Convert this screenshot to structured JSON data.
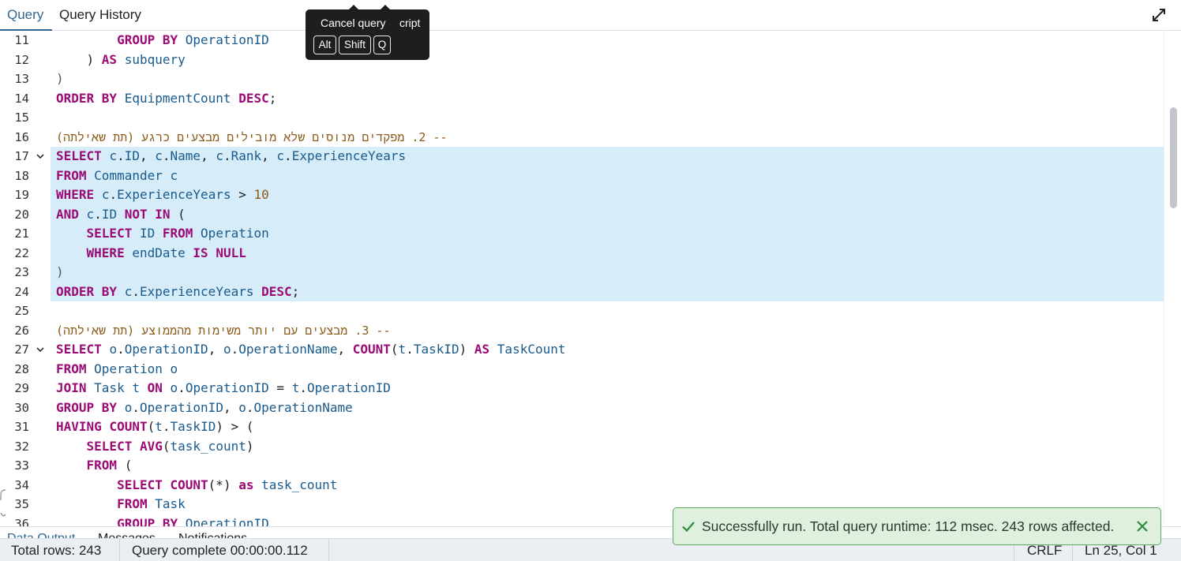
{
  "tabs": [
    {
      "label": "Query",
      "active": true
    },
    {
      "label": "Query History",
      "active": false
    }
  ],
  "tooltip": {
    "title": "Cancel query",
    "tail": "cript",
    "keys": [
      "Alt",
      "Shift",
      "Q"
    ]
  },
  "editor": {
    "lines": [
      {
        "n": "11",
        "fold": false,
        "hl": false,
        "tokens": [
          [
            "",
            "        "
          ],
          [
            "kw",
            "GROUP BY"
          ],
          [
            "",
            " "
          ],
          [
            "id",
            "OperationID"
          ]
        ]
      },
      {
        "n": "12",
        "fold": false,
        "hl": false,
        "tokens": [
          [
            "",
            "    ) "
          ],
          [
            "kw",
            "AS"
          ],
          [
            "",
            " "
          ],
          [
            "id",
            "subquery"
          ]
        ]
      },
      {
        "n": "13",
        "fold": false,
        "hl": false,
        "tokens": [
          [
            "op",
            ")"
          ]
        ]
      },
      {
        "n": "14",
        "fold": false,
        "hl": false,
        "tokens": [
          [
            "kw",
            "ORDER BY"
          ],
          [
            "",
            " "
          ],
          [
            "id",
            "EquipmentCount"
          ],
          [
            "",
            " "
          ],
          [
            "kw",
            "DESC"
          ],
          [
            "",
            ";"
          ]
        ]
      },
      {
        "n": "15",
        "fold": false,
        "hl": false,
        "tokens": []
      },
      {
        "n": "16",
        "fold": false,
        "hl": false,
        "tokens": [
          [
            "cm",
            "-- 2. מפקדים מנוסים שלא מובילים מבצעים כרגע (תת שאילתה)"
          ]
        ]
      },
      {
        "n": "17",
        "fold": true,
        "hl": true,
        "tokens": [
          [
            "kw",
            "SELECT"
          ],
          [
            "",
            " "
          ],
          [
            "id",
            "c"
          ],
          [
            "",
            "."
          ],
          [
            "id",
            "ID"
          ],
          [
            "",
            ", "
          ],
          [
            "id",
            "c"
          ],
          [
            "",
            "."
          ],
          [
            "id",
            "Name"
          ],
          [
            "",
            ", "
          ],
          [
            "id",
            "c"
          ],
          [
            "",
            "."
          ],
          [
            "id",
            "Rank"
          ],
          [
            "",
            ", "
          ],
          [
            "id",
            "c"
          ],
          [
            "",
            "."
          ],
          [
            "id",
            "ExperienceYears"
          ]
        ]
      },
      {
        "n": "18",
        "fold": false,
        "hl": true,
        "tokens": [
          [
            "kw",
            "FROM"
          ],
          [
            "",
            " "
          ],
          [
            "id",
            "Commander"
          ],
          [
            "",
            " "
          ],
          [
            "id",
            "c"
          ]
        ]
      },
      {
        "n": "19",
        "fold": false,
        "hl": true,
        "tokens": [
          [
            "kw",
            "WHERE"
          ],
          [
            "",
            " "
          ],
          [
            "id",
            "c"
          ],
          [
            "",
            "."
          ],
          [
            "id",
            "ExperienceYears"
          ],
          [
            "",
            " > "
          ],
          [
            "num",
            "10"
          ]
        ]
      },
      {
        "n": "20",
        "fold": false,
        "hl": true,
        "tokens": [
          [
            "kw",
            "AND"
          ],
          [
            "",
            " "
          ],
          [
            "id",
            "c"
          ],
          [
            "",
            "."
          ],
          [
            "id",
            "ID"
          ],
          [
            "",
            " "
          ],
          [
            "kw",
            "NOT IN"
          ],
          [
            "",
            " ("
          ]
        ]
      },
      {
        "n": "21",
        "fold": false,
        "hl": true,
        "tokens": [
          [
            "",
            "    "
          ],
          [
            "kw",
            "SELECT"
          ],
          [
            "",
            " "
          ],
          [
            "id",
            "ID"
          ],
          [
            "",
            " "
          ],
          [
            "kw",
            "FROM"
          ],
          [
            "",
            " "
          ],
          [
            "id",
            "Operation"
          ]
        ]
      },
      {
        "n": "22",
        "fold": false,
        "hl": true,
        "tokens": [
          [
            "",
            "    "
          ],
          [
            "kw",
            "WHERE"
          ],
          [
            "",
            " "
          ],
          [
            "id",
            "endDate"
          ],
          [
            "",
            " "
          ],
          [
            "kw",
            "IS NULL"
          ]
        ]
      },
      {
        "n": "23",
        "fold": false,
        "hl": true,
        "tokens": [
          [
            "op",
            ")"
          ]
        ]
      },
      {
        "n": "24",
        "fold": false,
        "hl": true,
        "tokens": [
          [
            "kw",
            "ORDER BY"
          ],
          [
            "",
            " "
          ],
          [
            "id",
            "c"
          ],
          [
            "",
            "."
          ],
          [
            "id",
            "ExperienceYears"
          ],
          [
            "",
            " "
          ],
          [
            "kw",
            "DESC"
          ],
          [
            "",
            ";"
          ]
        ]
      },
      {
        "n": "25",
        "fold": false,
        "hl": false,
        "tokens": []
      },
      {
        "n": "26",
        "fold": false,
        "hl": false,
        "tokens": [
          [
            "cm",
            "-- 3. מבצעים עם יותר משימות מהממוצע (תת שאילתה)"
          ]
        ]
      },
      {
        "n": "27",
        "fold": true,
        "hl": false,
        "tokens": [
          [
            "kw",
            "SELECT"
          ],
          [
            "",
            " "
          ],
          [
            "id",
            "o"
          ],
          [
            "",
            "."
          ],
          [
            "id",
            "OperationID"
          ],
          [
            "",
            ", "
          ],
          [
            "id",
            "o"
          ],
          [
            "",
            "."
          ],
          [
            "id",
            "OperationName"
          ],
          [
            "",
            ", "
          ],
          [
            "kw",
            "COUNT"
          ],
          [
            "",
            "("
          ],
          [
            "id",
            "t"
          ],
          [
            "",
            "."
          ],
          [
            "id",
            "TaskID"
          ],
          [
            "",
            ") "
          ],
          [
            "kw",
            "AS"
          ],
          [
            "",
            " "
          ],
          [
            "id",
            "TaskCount"
          ]
        ]
      },
      {
        "n": "28",
        "fold": false,
        "hl": false,
        "tokens": [
          [
            "kw",
            "FROM"
          ],
          [
            "",
            " "
          ],
          [
            "id",
            "Operation"
          ],
          [
            "",
            " "
          ],
          [
            "id",
            "o"
          ]
        ]
      },
      {
        "n": "29",
        "fold": false,
        "hl": false,
        "tokens": [
          [
            "kw",
            "JOIN"
          ],
          [
            "",
            " "
          ],
          [
            "id",
            "Task"
          ],
          [
            "",
            " "
          ],
          [
            "id",
            "t"
          ],
          [
            "",
            " "
          ],
          [
            "kw",
            "ON"
          ],
          [
            "",
            " "
          ],
          [
            "id",
            "o"
          ],
          [
            "",
            "."
          ],
          [
            "id",
            "OperationID"
          ],
          [
            "",
            " = "
          ],
          [
            "id",
            "t"
          ],
          [
            "",
            "."
          ],
          [
            "id",
            "OperationID"
          ]
        ]
      },
      {
        "n": "30",
        "fold": false,
        "hl": false,
        "tokens": [
          [
            "kw",
            "GROUP BY"
          ],
          [
            "",
            " "
          ],
          [
            "id",
            "o"
          ],
          [
            "",
            "."
          ],
          [
            "id",
            "OperationID"
          ],
          [
            "",
            ", "
          ],
          [
            "id",
            "o"
          ],
          [
            "",
            "."
          ],
          [
            "id",
            "OperationName"
          ]
        ]
      },
      {
        "n": "31",
        "fold": false,
        "hl": false,
        "tokens": [
          [
            "kw",
            "HAVING"
          ],
          [
            "",
            " "
          ],
          [
            "kw",
            "COUNT"
          ],
          [
            "",
            "("
          ],
          [
            "id",
            "t"
          ],
          [
            "",
            "."
          ],
          [
            "id",
            "TaskID"
          ],
          [
            "",
            ") > ("
          ]
        ]
      },
      {
        "n": "32",
        "fold": false,
        "hl": false,
        "tokens": [
          [
            "",
            "    "
          ],
          [
            "kw",
            "SELECT"
          ],
          [
            "",
            " "
          ],
          [
            "kw",
            "AVG"
          ],
          [
            "",
            "("
          ],
          [
            "id",
            "task_count"
          ],
          [
            "",
            ")"
          ]
        ]
      },
      {
        "n": "33",
        "fold": false,
        "hl": false,
        "tokens": [
          [
            "",
            "    "
          ],
          [
            "kw",
            "FROM"
          ],
          [
            "",
            " ("
          ]
        ]
      },
      {
        "n": "34",
        "fold": false,
        "hl": false,
        "tokens": [
          [
            "",
            "        "
          ],
          [
            "kw",
            "SELECT"
          ],
          [
            "",
            " "
          ],
          [
            "kw",
            "COUNT"
          ],
          [
            "",
            "(*) "
          ],
          [
            "kw",
            "as"
          ],
          [
            "",
            " "
          ],
          [
            "id",
            "task_count"
          ]
        ]
      },
      {
        "n": "35",
        "fold": false,
        "hl": false,
        "tokens": [
          [
            "",
            "        "
          ],
          [
            "kw",
            "FROM"
          ],
          [
            "",
            " "
          ],
          [
            "id",
            "Task"
          ]
        ]
      },
      {
        "n": "36",
        "fold": false,
        "hl": false,
        "tokens": [
          [
            "",
            "        "
          ],
          [
            "kw",
            "GROUP BY"
          ],
          [
            "",
            " "
          ],
          [
            "id",
            "OperationID"
          ]
        ]
      }
    ]
  },
  "bottom_tabs": [
    {
      "label": "Data Output"
    },
    {
      "label": "Messages"
    },
    {
      "label": "Notifications"
    }
  ],
  "status": {
    "total_rows": "Total rows: 243",
    "query_complete": "Query complete 00:00:00.112",
    "line_ending": "CRLF",
    "cursor": "Ln 25, Col 1"
  },
  "toast": {
    "message": "Successfully run. Total query runtime: 112 msec. 243 rows affected."
  },
  "colors": {
    "accent": "#326690",
    "keyword": "#9b0b75",
    "identifier": "#1a5b8d",
    "number": "#8a5a1a",
    "selection": "#d6ecf8",
    "toast_bg": "#dff0df",
    "toast_border": "#5da85d"
  }
}
